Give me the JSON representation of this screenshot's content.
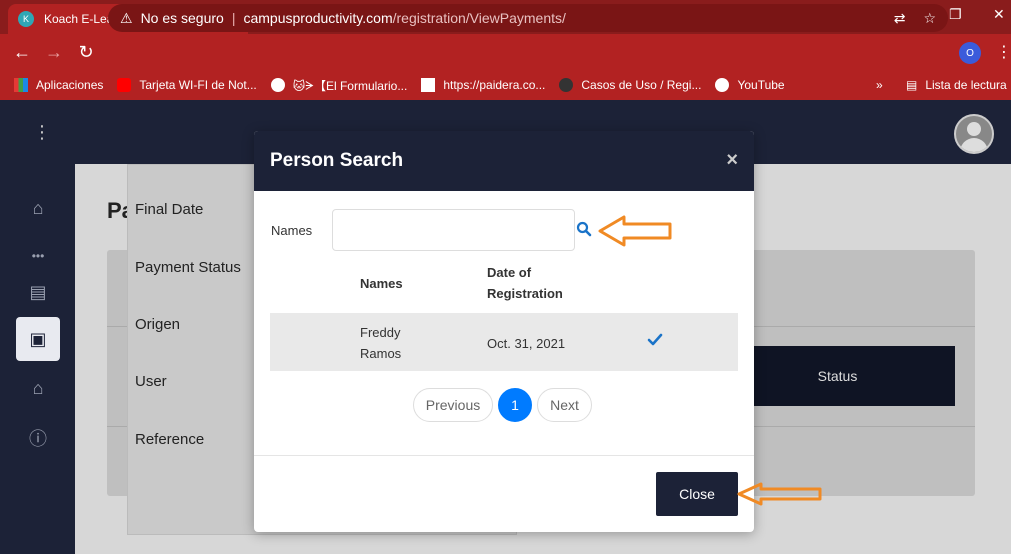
{
  "browser": {
    "tab_title": "Koach E-Learning",
    "security_label": "No es seguro",
    "url_domain": "campusproductivity.com",
    "url_path": "/registration/ViewPayments/",
    "profile_initial": "O",
    "bookmarks": [
      {
        "label": "Aplicaciones",
        "icon": "apps-icon"
      },
      {
        "label": "Tarjeta WI-FI de Not...",
        "icon": "youtube-icon"
      },
      {
        "label": "🐱ᗒ【El Formulario...",
        "icon": "globe-icon"
      },
      {
        "label": "https://paidera.co...",
        "icon": "page-icon"
      },
      {
        "label": "Casos de Uso / Regi...",
        "icon": "dark-circle-icon"
      },
      {
        "label": "YouTube",
        "icon": "globe-icon"
      }
    ],
    "bookmarks_more": "»",
    "reading_list": "Lista de lectura"
  },
  "page": {
    "title_partial": "Pa",
    "filter_labels": [
      "Final Date",
      "Payment Status",
      "Origen",
      "User",
      "Reference"
    ],
    "table_status_header": "Status"
  },
  "modal": {
    "title": "Person Search",
    "close_symbol": "×",
    "names_label": "Names",
    "names_value": "",
    "names_placeholder": "",
    "columns": {
      "names": "Names",
      "date_line1": "Date of",
      "date_line2": "Registration"
    },
    "rows": [
      {
        "name_line1": "Freddy",
        "name_line2": "Ramos",
        "date": "Oct. 31, 2021",
        "selected": true
      }
    ],
    "pagination": {
      "previous": "Previous",
      "current": "1",
      "next": "Next"
    },
    "close_button": "Close"
  },
  "colors": {
    "browser_red": "#b22222",
    "header_navy": "#1c2237",
    "accent_blue": "#007bff",
    "annotation_orange": "#f08a24"
  }
}
